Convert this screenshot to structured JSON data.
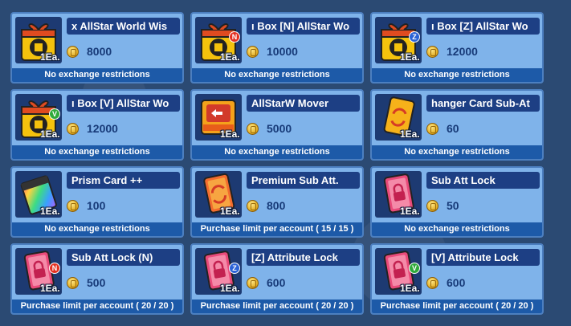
{
  "items": [
    {
      "name": "x     AllStar World Wis",
      "price": "8000",
      "qty": "1Ea.",
      "footer": "No exchange restrictions",
      "icon": "allstar-giftbox-icon",
      "badge": ""
    },
    {
      "name": "ı Box     [N] AllStar Wo",
      "price": "10000",
      "qty": "1Ea.",
      "footer": "No exchange restrictions",
      "icon": "allstar-giftbox-icon",
      "badge": "N"
    },
    {
      "name": "ı Box     [Z] AllStar Wo",
      "price": "12000",
      "qty": "1Ea.",
      "footer": "No exchange restrictions",
      "icon": "allstar-giftbox-icon",
      "badge": "Z"
    },
    {
      "name": "ı Box     [V] AllStar Wo",
      "price": "12000",
      "qty": "1Ea.",
      "footer": "No exchange restrictions",
      "icon": "allstar-giftbox-icon",
      "badge": "V"
    },
    {
      "name": "AllStarW Mover",
      "price": "5000",
      "qty": "1Ea.",
      "footer": "No exchange restrictions",
      "icon": "card-mover-icon",
      "badge": ""
    },
    {
      "name": "hanger     Card Sub-At",
      "price": "60",
      "qty": "1Ea.",
      "footer": "No exchange restrictions",
      "icon": "card-sub-att-changer-icon",
      "badge": ""
    },
    {
      "name": "Prism Card ++",
      "price": "100",
      "qty": "1Ea.",
      "footer": "No exchange restrictions",
      "icon": "prism-card-icon",
      "badge": ""
    },
    {
      "name": "Premium Sub Att.",
      "price": "800",
      "qty": "1Ea.",
      "footer": "Purchase limit per account ( 15 / 15 )",
      "icon": "premium-sub-att-card-icon",
      "badge": ""
    },
    {
      "name": "Sub Att Lock",
      "price": "50",
      "qty": "1Ea.",
      "footer": "No exchange restrictions",
      "icon": "sub-att-lock-card-icon",
      "badge": ""
    },
    {
      "name": "Sub Att Lock (N)",
      "price": "500",
      "qty": "1Ea.",
      "footer": "Purchase limit per account ( 20 / 20 )",
      "icon": "sub-att-lock-card-icon",
      "badge": "N"
    },
    {
      "name": "[Z] Attribute Lock",
      "price": "600",
      "qty": "1Ea.",
      "footer": "Purchase limit per account ( 20 / 20 )",
      "icon": "attribute-lock-card-icon",
      "badge": "Z"
    },
    {
      "name": "[V] Attribute Lock",
      "price": "600",
      "qty": "1Ea.",
      "footer": "Purchase limit per account ( 20 / 20 )",
      "icon": "attribute-lock-card-icon",
      "badge": "V"
    }
  ],
  "colors": {
    "background": "#2b4a73",
    "card": "#7fb3ea",
    "name_bar": "#1d3f84",
    "footer_bar": "#1d5aa8",
    "badge_n": "#e53020",
    "badge_z": "#2c63d6",
    "badge_v": "#2faa3a"
  }
}
